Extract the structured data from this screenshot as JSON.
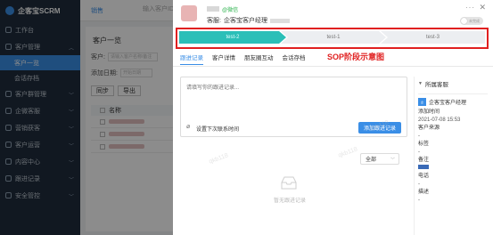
{
  "sidebar": {
    "brand": "企客宝SCRM",
    "items": [
      {
        "label": "工作台",
        "has_children": false
      },
      {
        "label": "客户管理",
        "has_children": true,
        "expanded": true
      },
      {
        "label": "客户群管理",
        "has_children": true
      },
      {
        "label": "企微客服",
        "has_children": true
      },
      {
        "label": "营销获客",
        "has_children": true
      },
      {
        "label": "客户运营",
        "has_children": true
      },
      {
        "label": "内容中心",
        "has_children": true
      },
      {
        "label": "跟进记录",
        "has_children": true
      },
      {
        "label": "安全管控",
        "has_children": true
      }
    ],
    "sub_items": [
      {
        "label": "客户一览",
        "active": true
      },
      {
        "label": "会话存档",
        "active": false
      }
    ]
  },
  "topbar": {
    "tab_label": "销售",
    "search_placeholder": "输入客户ID"
  },
  "main": {
    "title": "客户一览",
    "customer_label": "客户:",
    "customer_placeholder": "请输入客户名称/备注",
    "add_date_label": "添加日期:",
    "add_date_placeholder": "开始日期",
    "sync_button": "同步",
    "export_button": "导出",
    "name_header": "名称"
  },
  "drawer": {
    "wechat_tag": "@微信",
    "followup_label": "客服:",
    "followup_value": "企客宝客户经理",
    "toggle_label": "未完成",
    "steps": [
      {
        "label": "test-2",
        "active": true
      },
      {
        "label": "test-1",
        "active": false
      },
      {
        "label": "test-3",
        "active": false
      }
    ],
    "tabs": [
      {
        "label": "跟进记录",
        "active": true
      },
      {
        "label": "客户详情",
        "active": false
      },
      {
        "label": "朋友圈互动",
        "active": false
      },
      {
        "label": "会话存档",
        "active": false
      }
    ],
    "sop_annotation": "SOP阶段示意图",
    "compose_placeholder": "请填写你的跟进记录...",
    "remind_label": "设置下次联系时间",
    "submit_button": "添加跟进记录",
    "filter_value": "全部",
    "empty_text": "暂无跟进记录",
    "panel": {
      "title": "所属客服",
      "owner_name": "企客宝客户经理",
      "add_time_label": "添加时间",
      "add_time_value": "2021-07-08 15:53",
      "source_label": "客户来源",
      "source_value": "-",
      "tags_label": "标签",
      "tags_value": "-",
      "remark_label": "备注",
      "phone_label": "电话",
      "phone_value": "-",
      "desc_label": "描述",
      "desc_value": "-"
    }
  },
  "watermark": "qkb118"
}
